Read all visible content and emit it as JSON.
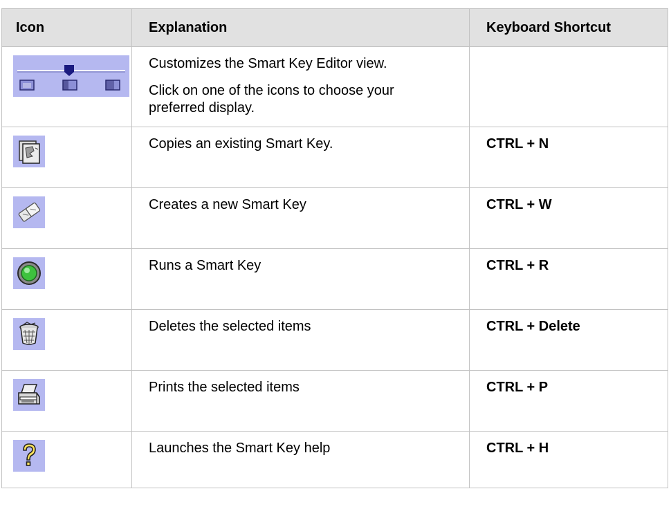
{
  "headers": {
    "icon": "Icon",
    "explanation": "Explanation",
    "shortcut": "Keyboard Shortcut"
  },
  "rows": [
    {
      "icon": "display-slider-icon",
      "explanation": [
        "Customizes the Smart Key Editor view.",
        "Click on one of the icons to choose your preferred display."
      ],
      "shortcut": ""
    },
    {
      "icon": "copy-icon",
      "explanation": [
        "Copies an existing Smart Key."
      ],
      "shortcut": "CTRL + N"
    },
    {
      "icon": "new-key-icon",
      "explanation": [
        "Creates a new Smart Key"
      ],
      "shortcut": "CTRL + W"
    },
    {
      "icon": "run-icon",
      "explanation": [
        "Runs a Smart Key"
      ],
      "shortcut": "CTRL + R"
    },
    {
      "icon": "trash-icon",
      "explanation": [
        "Deletes the selected items"
      ],
      "shortcut": "CTRL + Delete"
    },
    {
      "icon": "printer-icon",
      "explanation": [
        "Prints the selected items"
      ],
      "shortcut": "CTRL + P"
    },
    {
      "icon": "help-icon",
      "explanation": [
        "Launches the Smart Key help"
      ],
      "shortcut": "CTRL + H"
    }
  ],
  "colors": {
    "header_bg": "#e1e1e1",
    "icon_bg": "#b5b8f0",
    "border": "#c2c2c2"
  }
}
